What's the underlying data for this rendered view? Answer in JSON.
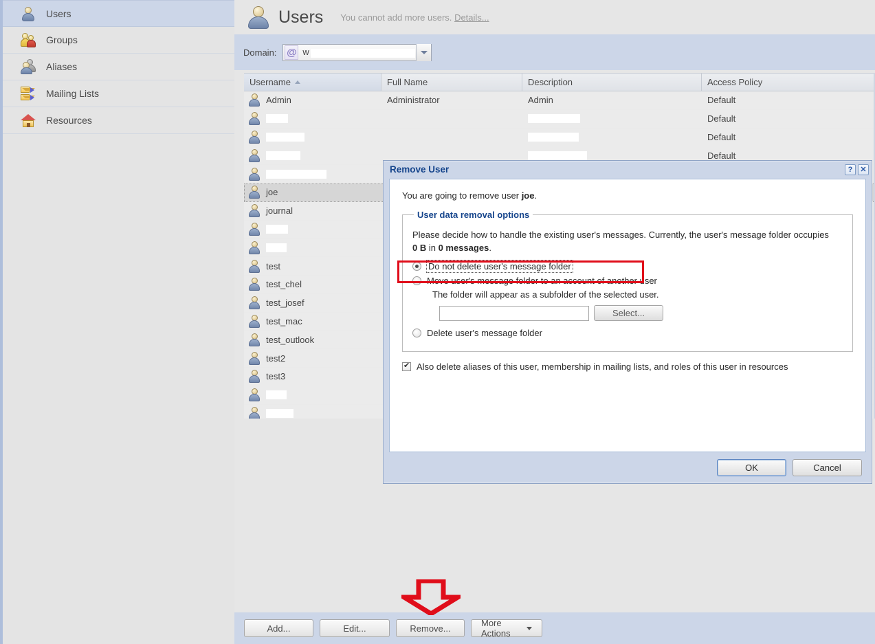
{
  "sidebar": {
    "items": [
      {
        "label": "Users",
        "icon": "person-icon",
        "selected": true
      },
      {
        "label": "Groups",
        "icon": "groups-icon",
        "selected": false
      },
      {
        "label": "Aliases",
        "icon": "aliases-icon",
        "selected": false
      },
      {
        "label": "Mailing Lists",
        "icon": "mailing-list-icon",
        "selected": false
      },
      {
        "label": "Resources",
        "icon": "house-icon",
        "selected": false
      }
    ]
  },
  "header": {
    "title": "Users",
    "icon": "user-large-icon",
    "note": "You cannot add more users.",
    "details_link": "Details..."
  },
  "domain": {
    "label": "Domain:",
    "at_symbol": "@",
    "value_prefix": "w",
    "value_redacted": true,
    "dropdown_icon": "chevron-down-icon"
  },
  "table": {
    "columns": [
      {
        "key": "username",
        "label": "Username",
        "sorted": true,
        "sort_dir": "asc"
      },
      {
        "key": "fullname",
        "label": "Full Name",
        "sorted": false
      },
      {
        "key": "description",
        "label": "Description",
        "sorted": false
      },
      {
        "key": "access",
        "label": "Access Policy",
        "sorted": false
      }
    ],
    "rows": [
      {
        "username": "Admin",
        "username_redacted": false,
        "fullname": "Administrator",
        "description": "Admin",
        "description_redacted": false,
        "access": "Default",
        "selected": false
      },
      {
        "username": "",
        "username_redacted": true,
        "redact_w": 32,
        "fullname": "",
        "description": "",
        "description_redacted": true,
        "desc_redact_w": 76,
        "access": "Default",
        "selected": false
      },
      {
        "username": "",
        "username_redacted": true,
        "redact_w": 56,
        "fullname": "",
        "description": "",
        "description_redacted": true,
        "desc_redact_w": 74,
        "access": "Default",
        "selected": false
      },
      {
        "username": "",
        "username_redacted": true,
        "redact_w": 50,
        "fullname": "",
        "description": "",
        "description_redacted": true,
        "desc_redact_w": 86,
        "access": "Default",
        "selected": false
      },
      {
        "username": "",
        "username_redacted": true,
        "redact_w": 88,
        "fullname": "",
        "description": "",
        "description_redacted": false,
        "access": "",
        "selected": false
      },
      {
        "username": "joe",
        "username_redacted": false,
        "fullname": "",
        "description": "",
        "description_redacted": false,
        "access": "",
        "selected": true
      },
      {
        "username": "journal",
        "username_redacted": false,
        "fullname": "",
        "description": "",
        "description_redacted": false,
        "access": "",
        "selected": false
      },
      {
        "username": "",
        "username_redacted": true,
        "redact_w": 32,
        "fullname": "",
        "description": "",
        "description_redacted": false,
        "access": "",
        "selected": false
      },
      {
        "username": "",
        "username_redacted": true,
        "redact_w": 30,
        "fullname": "",
        "description": "",
        "description_redacted": false,
        "access": "",
        "selected": false
      },
      {
        "username": "test",
        "username_redacted": false,
        "fullname": "",
        "description": "",
        "description_redacted": false,
        "access": "",
        "selected": false
      },
      {
        "username": "test_chel",
        "username_redacted": false,
        "fullname": "",
        "description": "",
        "description_redacted": false,
        "access": "",
        "selected": false
      },
      {
        "username": "test_josef",
        "username_redacted": false,
        "fullname": "",
        "description": "",
        "description_redacted": false,
        "access": "",
        "selected": false
      },
      {
        "username": "test_mac",
        "username_redacted": false,
        "fullname": "",
        "description": "",
        "description_redacted": false,
        "access": "",
        "selected": false
      },
      {
        "username": "test_outlook",
        "username_redacted": false,
        "fullname": "",
        "description": "",
        "description_redacted": false,
        "access": "",
        "selected": false
      },
      {
        "username": "test2",
        "username_redacted": false,
        "fullname": "",
        "description": "",
        "description_redacted": false,
        "access": "",
        "selected": false
      },
      {
        "username": "test3",
        "username_redacted": false,
        "fullname": "",
        "description": "",
        "description_redacted": false,
        "access": "",
        "selected": false
      },
      {
        "username": "",
        "username_redacted": true,
        "redact_w": 30,
        "fullname": "",
        "description": "",
        "description_redacted": false,
        "access": "",
        "selected": false
      },
      {
        "username": "",
        "username_redacted": true,
        "redact_w": 40,
        "fullname": "",
        "description": "",
        "description_redacted": false,
        "access": "",
        "selected": false
      }
    ]
  },
  "toolbar": {
    "add_label": "Add...",
    "edit_label": "Edit...",
    "remove_label": "Remove...",
    "more_actions_label": "More Actions",
    "more_actions_caret": "caret-down-icon"
  },
  "annotation": {
    "arrow": "red-down-arrow",
    "arrow_color": "#e00d1a",
    "highlight_color": "#e00d1a"
  },
  "dialog": {
    "title": "Remove User",
    "help_button": "?",
    "close_button": "✕",
    "intro_prefix": "You are going to remove user ",
    "intro_user": "joe",
    "intro_suffix": ".",
    "fieldset_legend": "User data removal options",
    "description_line1": "Please decide how to handle the existing user's messages. Currently, the user's message folder occupies",
    "description_size": "0 B",
    "description_mid": " in ",
    "description_count": "0 messages",
    "description_end": ".",
    "options": [
      {
        "label": "Do not delete user's message folder",
        "checked": true,
        "focused": true,
        "highlighted": true
      },
      {
        "label": "Move user's message folder to an account of another user",
        "checked": false,
        "focused": false,
        "highlighted": false
      },
      {
        "label": "Delete user's message folder",
        "checked": false,
        "focused": false,
        "highlighted": false
      }
    ],
    "move_subnote": "The folder will appear as a subfolder of the selected user.",
    "folder_input_value": "",
    "folder_input_placeholder": "",
    "select_button": "Select...",
    "also_delete_checked": true,
    "also_delete_label": "Also delete aliases of this user, membership in mailing lists, and roles of this user in resources",
    "ok_label": "OK",
    "cancel_label": "Cancel"
  }
}
